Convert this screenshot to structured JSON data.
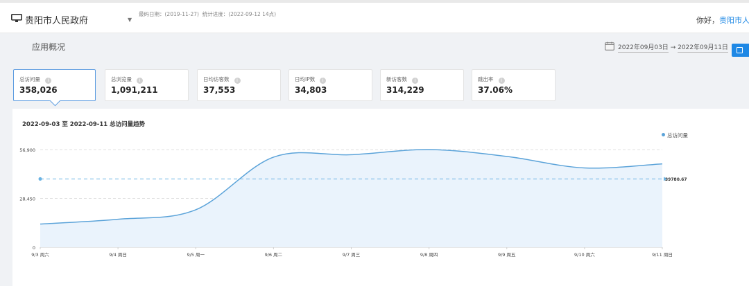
{
  "header": {
    "site_name": "贵阳市人民政府",
    "last_update_label": "最码日期：(2019-11-27)",
    "stat_progress_label": "统计进度：(2022-09-12 14点)",
    "greeting": "你好，",
    "user_name": "贵阳市人民"
  },
  "page": {
    "subtitle": "应用概况",
    "date_start": "2022年09月03日",
    "date_arrow": "→",
    "date_end": "2022年09月11日"
  },
  "metrics": [
    {
      "label": "总访问量",
      "value": "358,026",
      "active": true
    },
    {
      "label": "总浏览量",
      "value": "1,091,211",
      "active": false
    },
    {
      "label": "日均访客数",
      "value": "37,553",
      "active": false
    },
    {
      "label": "日均IP数",
      "value": "34,803",
      "active": false
    },
    {
      "label": "新访客数",
      "value": "314,229",
      "active": false
    },
    {
      "label": "跳出率",
      "value": "37.06%",
      "active": false
    }
  ],
  "chart_title": "2022-09-03 至 2022-09-11 总访问量趋势",
  "chart_data": {
    "type": "area",
    "title": "2022-09-03 至 2022-09-11 总访问量趋势",
    "categories": [
      "9/3 周六",
      "9/4 周日",
      "9/5 周一",
      "9/6 周二",
      "9/7 周三",
      "9/8 周四",
      "9/9 周五",
      "9/10 周六",
      "9/11 周日"
    ],
    "series": [
      {
        "name": "总访问量",
        "values": [
          13500,
          16300,
          21800,
          52500,
          53900,
          56900,
          52900,
          46200,
          48600
        ]
      }
    ],
    "y_ticks": [
      0,
      28450,
      56900
    ],
    "y_tick_labels": [
      "0",
      "28,450",
      "56,900"
    ],
    "ylim": [
      0,
      56900
    ],
    "average_line": {
      "value": 39780.67,
      "label": "39780.67"
    },
    "legend_position": "top-right",
    "grid": true,
    "colors": {
      "line": "#5ba3d9",
      "fill": "#eaf3fc",
      "average": "#6ab3e3"
    }
  }
}
